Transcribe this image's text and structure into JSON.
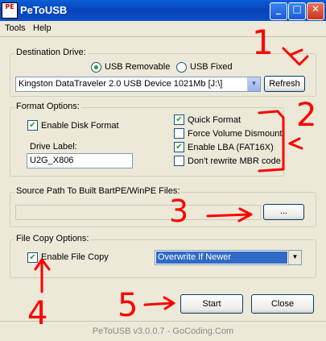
{
  "window": {
    "icon_text": "PE",
    "title": "PeToUSB",
    "minimize_glyph": "_",
    "maximize_glyph": "□",
    "close_glyph": "✕"
  },
  "menu": {
    "items": [
      "Tools",
      "Help"
    ]
  },
  "destination": {
    "legend": "Destination Drive:",
    "usb_removable_label": "USB Removable",
    "usb_fixed_label": "USB Fixed",
    "usb_removable_selected": true,
    "drive_value": "Kingston DataTraveler 2.0 USB Device 1021Mb [J:\\]",
    "refresh_label": "Refresh"
  },
  "format": {
    "legend": "Format Options:",
    "enable_disk_format_label": "Enable Disk Format",
    "drive_label_caption": "Drive Label:",
    "drive_label_value": "U2G_X806",
    "quick_format_label": "Quick Format",
    "force_dismount_label": "Force Volume Dismount",
    "enable_lba_label": "Enable LBA (FAT16X)",
    "dont_rewrite_mbr_label": "Don't rewrite MBR code",
    "checks": {
      "enable_disk_format": true,
      "quick_format": true,
      "force_dismount": false,
      "enable_lba": true,
      "dont_rewrite_mbr": false
    }
  },
  "source": {
    "legend": "Source Path To Built BartPE/WinPE Files:",
    "path_value": "",
    "browse_label": "..."
  },
  "copy": {
    "legend": "File Copy Options:",
    "enable_file_copy_label": "Enable File Copy",
    "enable_file_copy_checked": true,
    "mode_value": "Overwrite If Newer"
  },
  "actions": {
    "start_label": "Start",
    "close_label": "Close"
  },
  "status": {
    "text": "PeToUSB v3.0.0.7 - GoCoding.Com"
  },
  "annotations": {
    "n1": "1",
    "n2": "2",
    "n3": "3",
    "n4": "4",
    "n5": "5"
  },
  "colors": {
    "annotation": "#ff0000",
    "title_bar": "#0a50c8",
    "selection": "#316ac5"
  }
}
